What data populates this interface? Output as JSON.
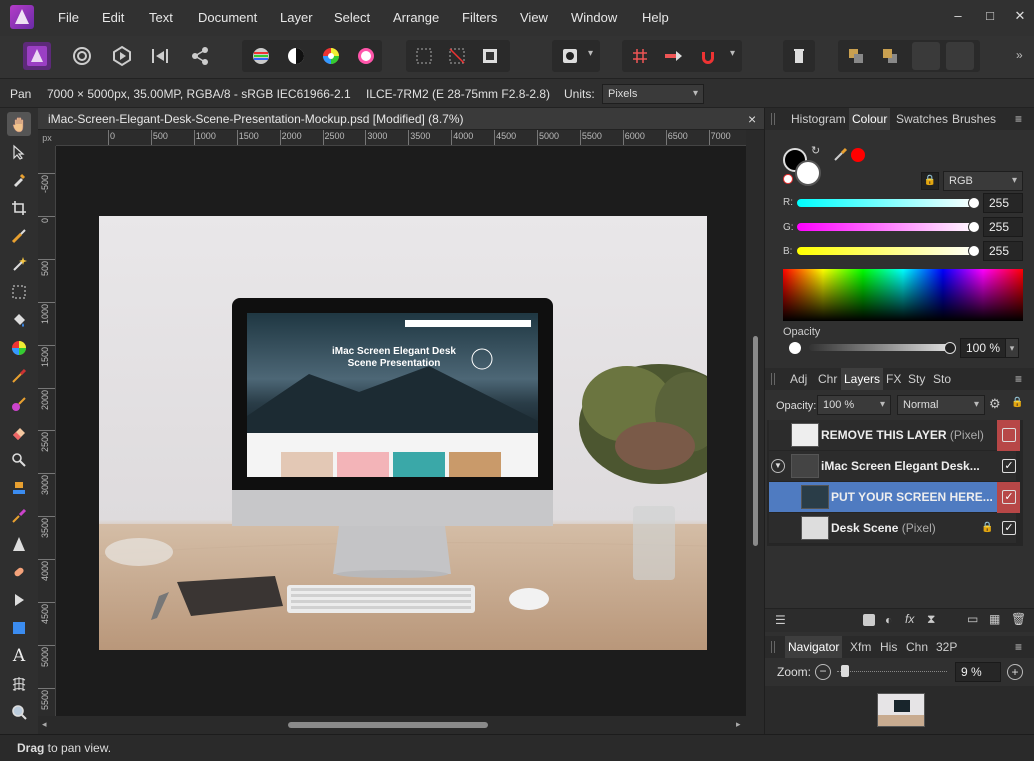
{
  "menubar": {
    "items": [
      "File",
      "Edit",
      "Text",
      "Document",
      "Layer",
      "Select",
      "Arrange",
      "Filters",
      "View",
      "Window",
      "Help"
    ],
    "window_controls": [
      "minimize-icon",
      "maximize-icon",
      "close-icon"
    ]
  },
  "context": {
    "tool_name": "Pan",
    "doc_info": "7000 × 5000px, 35.00MP, RGBA/8 - sRGB IEC61966-2.1",
    "camera": "ILCE-7RM2 (E 28-75mm F2.8-2.8)",
    "units_label": "Units:",
    "units_value": "Pixels"
  },
  "document": {
    "tab_title": "iMac-Screen-Elegant-Desk-Scene-Presentation-Mockup.psd [Modified] (8.7%)",
    "close": "×"
  },
  "ruler": {
    "unit": "px",
    "top_ticks": [
      "0",
      "500",
      "1000",
      "1500",
      "2000",
      "2500",
      "3000",
      "3500",
      "4000",
      "4500",
      "5000",
      "5500",
      "6000",
      "6500",
      "7000"
    ],
    "left_ticks": [
      "-500",
      "0",
      "500",
      "1000",
      "1500",
      "2000",
      "2500",
      "3000",
      "3500",
      "4000",
      "4500",
      "5000",
      "5500"
    ]
  },
  "screen": {
    "headline1": "iMac Screen Elegant Desk",
    "headline2": "Scene Presentation"
  },
  "status": {
    "bold": "Drag",
    "rest": " to pan view."
  },
  "colour_panel": {
    "tabs": [
      "Histogram",
      "Colour",
      "Swatches",
      "Brushes"
    ],
    "active_tab": "Colour",
    "mode": "RGB",
    "r_label": "R:",
    "g_label": "G:",
    "b_label": "B:",
    "r": "255",
    "g": "255",
    "b": "255",
    "opacity_label": "Opacity",
    "opacity": "100 %"
  },
  "layers_panel": {
    "tabs": [
      "Adj",
      "Chr",
      "Layers",
      "FX",
      "Sty",
      "Sto"
    ],
    "active_tab": "Layers",
    "opacity_label": "Opacity:",
    "opacity": "100 %",
    "blend": "Normal",
    "layers": [
      {
        "name": "REMOVE THIS LAYER",
        "type": "(Pixel)",
        "checked": false
      },
      {
        "name": "iMac Screen Elegant Desk...",
        "type": "",
        "checked": true
      },
      {
        "name": "PUT YOUR SCREEN HERE...",
        "type": "",
        "checked": true
      },
      {
        "name": "Desk Scene",
        "type": "(Pixel)",
        "checked": true
      }
    ]
  },
  "navigator_panel": {
    "tabs": [
      "Navigator",
      "Xfm",
      "His",
      "Chn",
      "32P"
    ],
    "active_tab": "Navigator",
    "zoom_label": "Zoom:",
    "zoom": "9 %"
  },
  "colors": {
    "accent": "#4f7bc1",
    "app_bg": "#2a2a2a",
    "red_swatch": "#ff0000"
  }
}
